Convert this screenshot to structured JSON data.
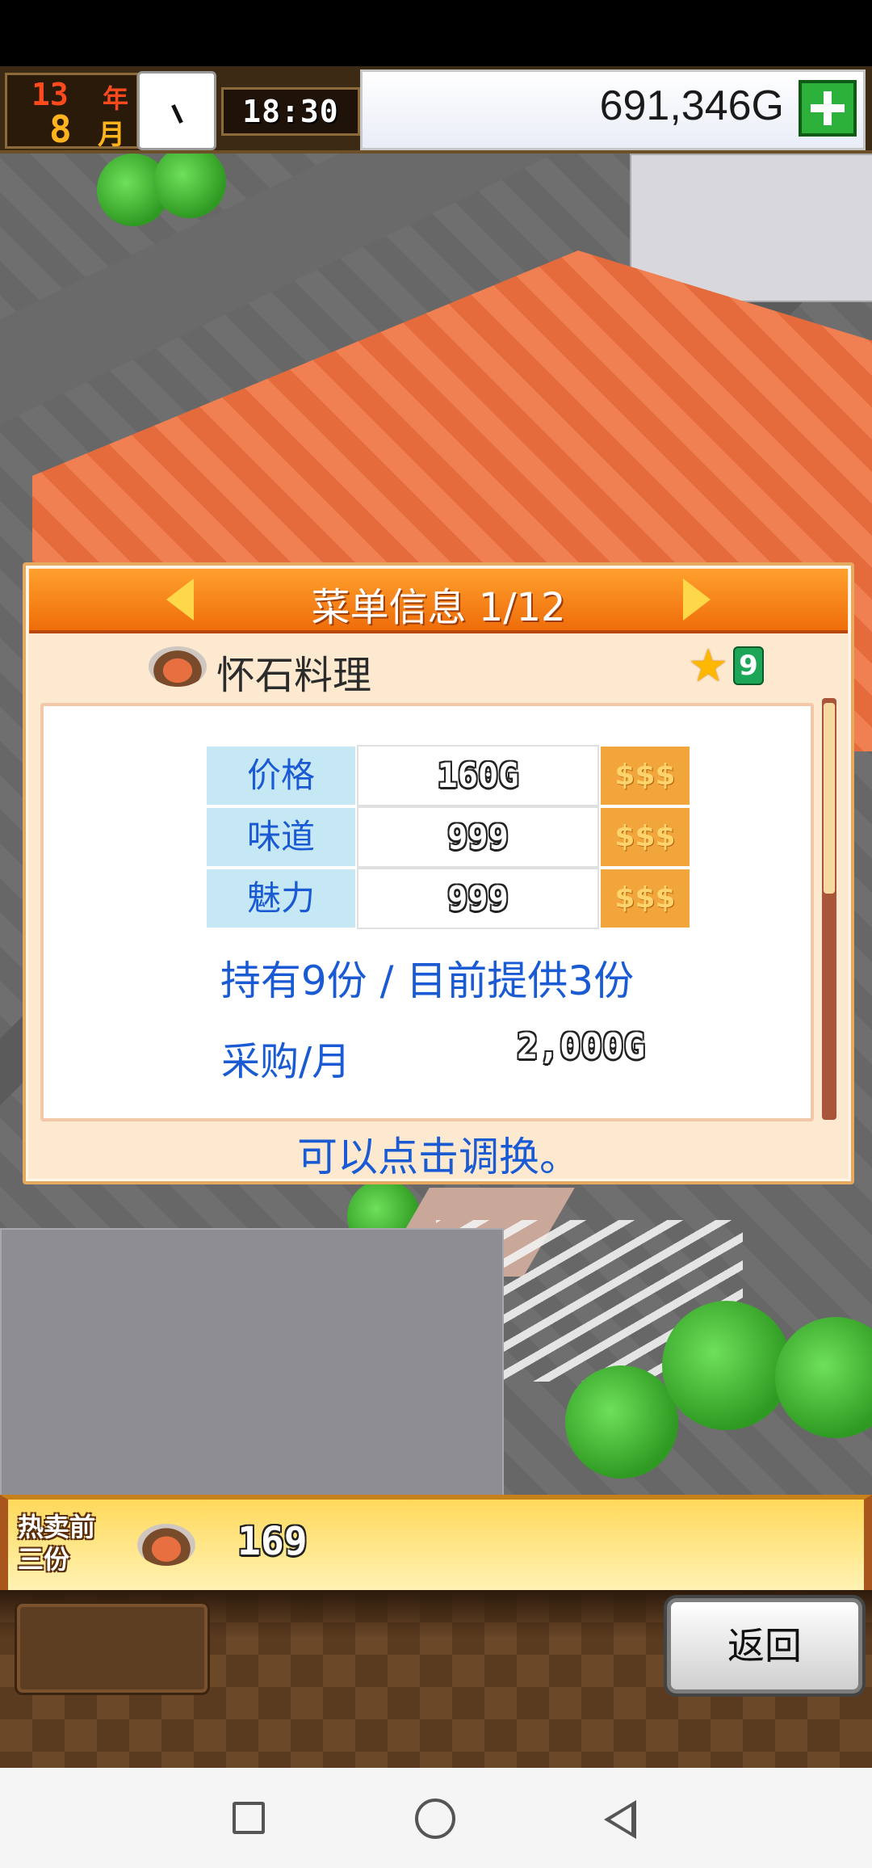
{
  "hud": {
    "year_number": "13",
    "year_label": "年",
    "month_number": "8",
    "month_label": "月",
    "time": "18:30",
    "money": "691,346G"
  },
  "panel": {
    "title": "菜单信息 1/12",
    "dish": {
      "name": "怀石料理",
      "rank": "9"
    },
    "stats": [
      {
        "label": "价格",
        "value": "160G",
        "rating": "$$$"
      },
      {
        "label": "味道",
        "value": "999",
        "rating": "$$$"
      },
      {
        "label": "魅力",
        "value": "999",
        "rating": "$$$"
      }
    ],
    "owned": "持有9份 / 目前提供3份",
    "purchase_label": "采购/月",
    "purchase_value": "2,000G",
    "hint": "可以点击调换。"
  },
  "bestseller": {
    "label": "热卖前三份",
    "count": "169"
  },
  "actions": {
    "back_label": "返回"
  },
  "colors": {
    "header_orange": "#ef6d0a",
    "stat_text_blue": "#1a5bd4",
    "money_plus_green": "#2bb13a"
  },
  "icons": {
    "clock": "clock-icon",
    "plus": "plus-icon",
    "dish": "dish-icon",
    "star": "star-icon"
  }
}
